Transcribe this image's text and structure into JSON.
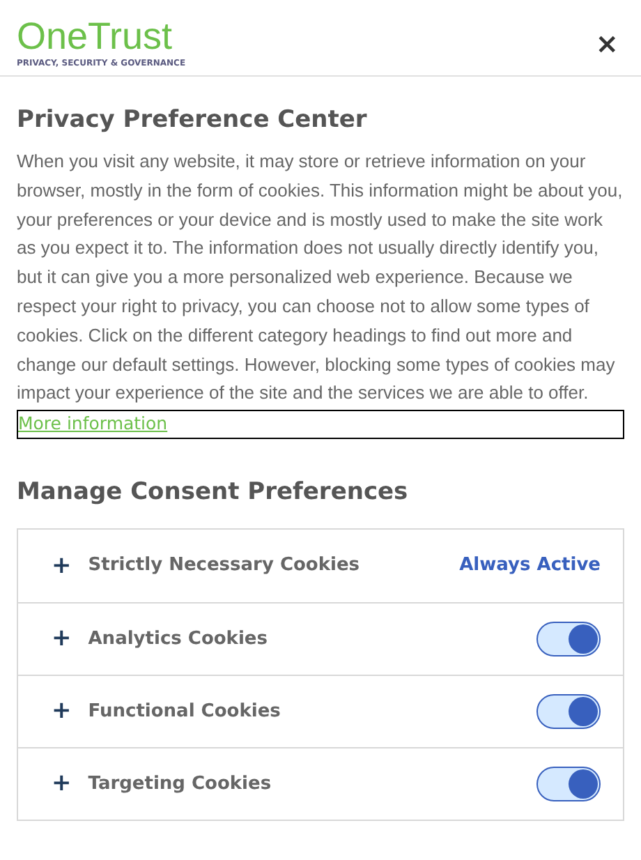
{
  "logo": {
    "name": "OneTrust",
    "tagline": "PRIVACY, SECURITY & GOVERNANCE"
  },
  "close": "×",
  "title": "Privacy Preference Center",
  "description": "When you visit any website, it may store or retrieve information on your browser, mostly in the form of cookies. This information might be about you, your preferences or your device and is mostly used to make the site work as you expect it to. The information does not usually directly identify you, but it can give you a more personalized web experience. Because we respect your right to privacy, you can choose not to allow some types of cookies. Click on the different category headings to find out more and change our default settings. However, blocking some types of cookies may impact your experience of the site and the services we are able to offer.",
  "more_link": "More information",
  "section_title": "Manage Consent Preferences",
  "categories": [
    {
      "kind": "status",
      "expander": "+",
      "label": "Strictly Necessary Cookies",
      "status": "Always Active"
    },
    {
      "kind": "toggle",
      "expander": "+",
      "label": "Analytics Cookies",
      "on": true
    },
    {
      "kind": "toggle",
      "expander": "+",
      "label": "Functional Cookies",
      "on": true
    },
    {
      "kind": "toggle",
      "expander": "+",
      "label": "Targeting Cookies",
      "on": true
    }
  ]
}
